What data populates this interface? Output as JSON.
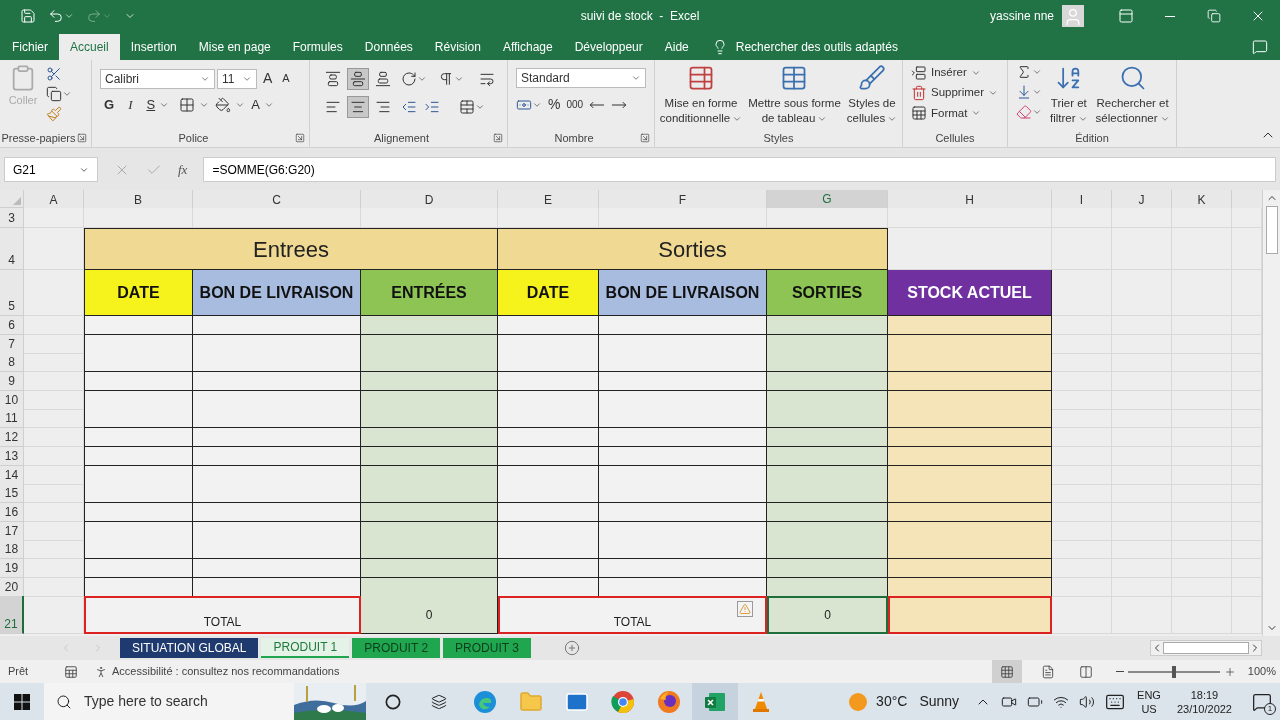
{
  "window": {
    "title": "suivi de stock  -  Excel",
    "user": "yassine nne"
  },
  "menu_tabs": [
    {
      "label": "Fichier",
      "selected": false
    },
    {
      "label": "Accueil",
      "selected": true
    },
    {
      "label": "Insertion",
      "selected": false
    },
    {
      "label": "Mise en page",
      "selected": false
    },
    {
      "label": "Formules",
      "selected": false
    },
    {
      "label": "Données",
      "selected": false
    },
    {
      "label": "Révision",
      "selected": false
    },
    {
      "label": "Affichage",
      "selected": false
    },
    {
      "label": "Développeur",
      "selected": false
    },
    {
      "label": "Aide",
      "selected": false
    }
  ],
  "tell_me": "Rechercher des outils adaptés",
  "ribbon": {
    "clipboard": {
      "label": "Presse-papiers",
      "paste": {
        "label": "Coller",
        "disabled": true
      }
    },
    "font": {
      "label": "Police",
      "font_name": "Calibri",
      "font_size": "11",
      "grow": "A",
      "shrink": "A",
      "bold": "G",
      "italic": "I",
      "underline": "S",
      "font_color": "A"
    },
    "alignment": {
      "label": "Alignement",
      "vertical": [
        {
          "selected": false
        },
        {
          "selected": true
        },
        {
          "selected": false
        }
      ],
      "horizontal": [
        {
          "selected": false
        },
        {
          "selected": true
        },
        {
          "selected": false
        }
      ]
    },
    "number": {
      "label": "Nombre",
      "format": "Standard",
      "percent": "%",
      "thousands": "000"
    },
    "styles": {
      "label": "Styles",
      "buttons": [
        {
          "kind": "conditional",
          "lines": [
            "Mise en forme",
            "conditionnelle"
          ]
        },
        {
          "kind": "table",
          "lines": [
            "Mettre sous forme",
            "de tableau"
          ]
        },
        {
          "kind": "cell",
          "lines": [
            "Styles de",
            "cellules"
          ]
        }
      ]
    },
    "cells": {
      "label": "Cellules",
      "buttons": [
        {
          "kind": "insert",
          "label": "Insérer"
        },
        {
          "kind": "delete",
          "label": "Supprimer"
        },
        {
          "kind": "format",
          "label": "Format"
        }
      ]
    },
    "editing": {
      "label": "Édition",
      "buttons": [
        {
          "kind": "sort",
          "lines": [
            "Trier et",
            "filtrer"
          ]
        },
        {
          "kind": "find",
          "lines": [
            "Rechercher et",
            "sélectionner"
          ]
        }
      ]
    }
  },
  "formula_bar": {
    "name_box": "G21",
    "fx": "fx",
    "formula": "=SOMME(G6:G20)"
  },
  "columns": [
    {
      "label": "A",
      "selected": false
    },
    {
      "label": "B",
      "selected": false
    },
    {
      "label": "C",
      "selected": false
    },
    {
      "label": "D",
      "selected": false
    },
    {
      "label": "E",
      "selected": false
    },
    {
      "label": "F",
      "selected": false
    },
    {
      "label": "G",
      "selected": true
    },
    {
      "label": "H",
      "selected": false
    },
    {
      "label": "I",
      "selected": false
    },
    {
      "label": "J",
      "selected": false
    },
    {
      "label": "K",
      "selected": false
    }
  ],
  "rows": [
    {
      "label": "3",
      "selected": false
    },
    {
      "label": "4",
      "selected": false
    },
    {
      "label": "5",
      "selected": false
    },
    {
      "label": "6",
      "selected": false
    },
    {
      "label": "7",
      "selected": false
    },
    {
      "label": "8",
      "selected": false
    },
    {
      "label": "9",
      "selected": false
    },
    {
      "label": "10",
      "selected": false
    },
    {
      "label": "11",
      "selected": false
    },
    {
      "label": "12",
      "selected": false
    },
    {
      "label": "13",
      "selected": false
    },
    {
      "label": "14",
      "selected": false
    },
    {
      "label": "15",
      "selected": false
    },
    {
      "label": "16",
      "selected": false
    },
    {
      "label": "17",
      "selected": false
    },
    {
      "label": "18",
      "selected": false
    },
    {
      "label": "19",
      "selected": false
    },
    {
      "label": "20",
      "selected": false
    },
    {
      "label": "21",
      "selected": true
    }
  ],
  "table": {
    "groups": [
      "Entrees",
      "Sorties"
    ],
    "headers": [
      {
        "label": "DATE",
        "color": "#f5f21c"
      },
      {
        "label": "BON DE LIVRAISON",
        "color": "#a8bce0"
      },
      {
        "label": "ENTRÉES",
        "color": "#8ec453"
      },
      {
        "label": "DATE",
        "color": "#f5f21c"
      },
      {
        "label": "BON DE LIVRAISON",
        "color": "#a8bce0"
      },
      {
        "label": "SORTIES",
        "color": "#8ec453"
      },
      {
        "label": "STOCK ACTUEL",
        "color": "#7030a0"
      }
    ],
    "totals": [
      {
        "label": "TOTAL",
        "value": "0",
        "warning": false
      },
      {
        "label": "TOTAL",
        "value": "0",
        "warning": true
      }
    ]
  },
  "sheet_tabs": [
    {
      "label": "SITUATION GLOBAL",
      "color": "#1f3a6e",
      "selected": false
    },
    {
      "label": "PRODUIT 1",
      "color": "#1fa64f",
      "selected": true
    },
    {
      "label": "PRODUIT 2",
      "color": "#1fa64f",
      "selected": false
    },
    {
      "label": "PRODUIT 3",
      "color": "#1fa64f",
      "selected": false
    }
  ],
  "status_bar": {
    "status": "Prêt",
    "accessibility": "Accessibilité : consultez nos recommandations",
    "zoom": {
      "label": "100%",
      "level": 0.5
    }
  },
  "taskbar": {
    "search_placeholder": "Type here to search",
    "temperature": "30°C",
    "weather": "Sunny",
    "language": "ENG",
    "region": "US",
    "time": "18:19",
    "date": "23/10/2022",
    "notifications": "1"
  }
}
